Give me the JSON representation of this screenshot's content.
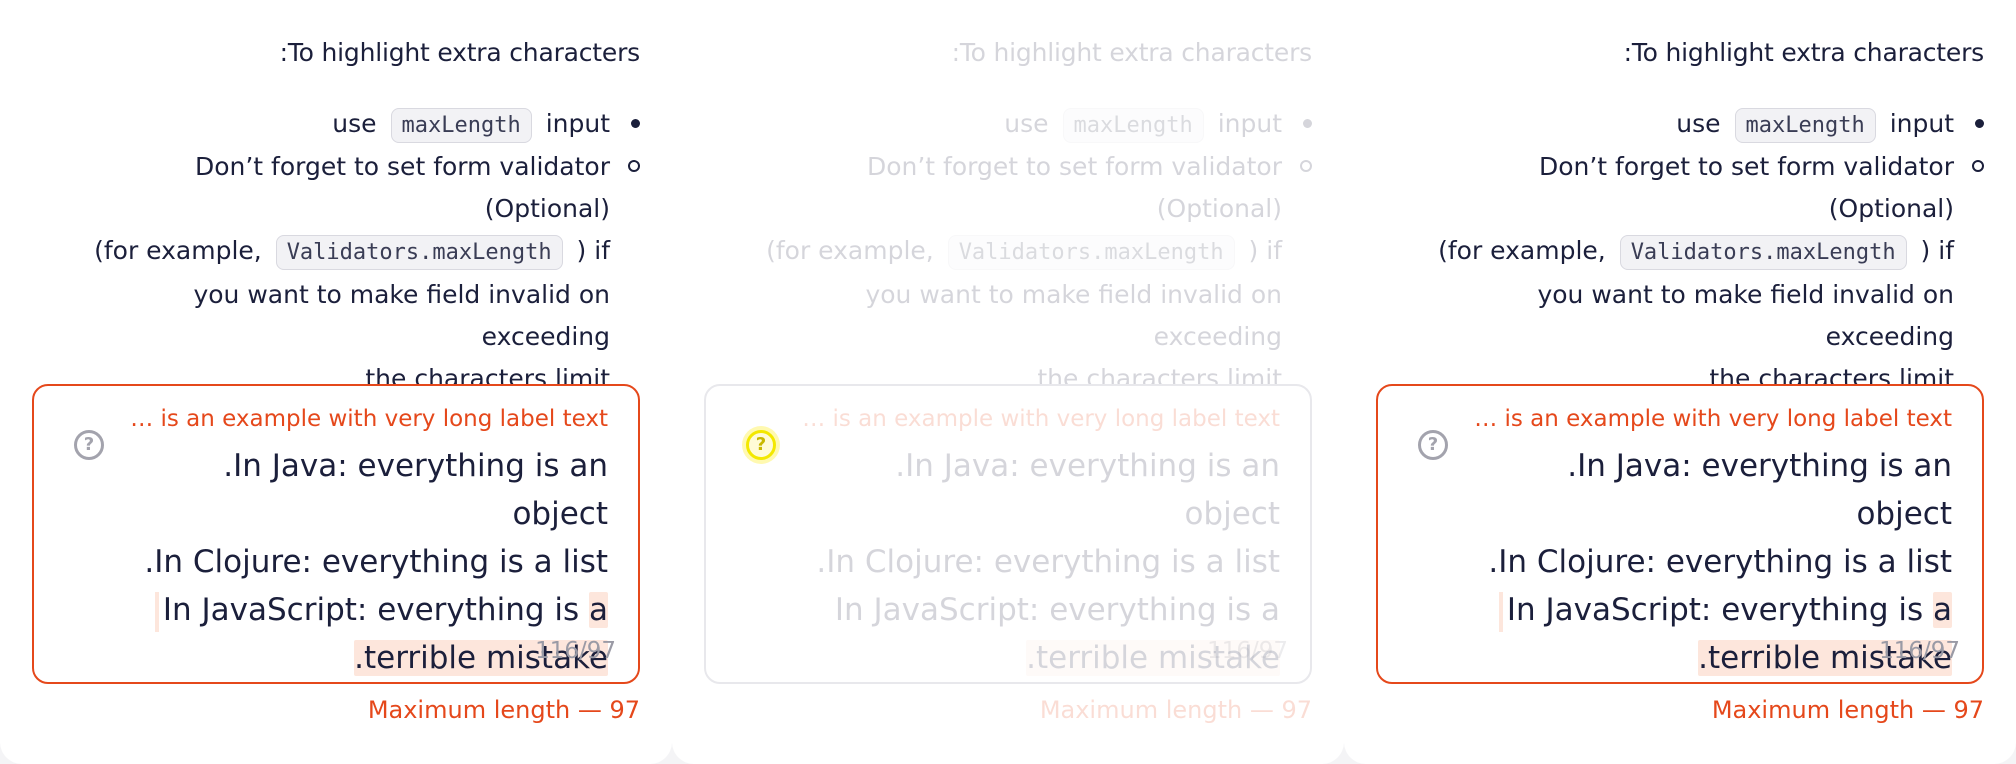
{
  "panels": [
    {
      "heading": ":To highlight extra characters",
      "bullet1": {
        "pre": "use",
        "code": "maxLength",
        "post": "input"
      },
      "bullet2": {
        "line1": "Don’t forget to set form validator (Optional)",
        "pre": "(for example,",
        "code": "Validators.maxLength",
        "post": ") if",
        "line3": "you want to make field invalid on exceeding",
        "line4": "the characters limit"
      },
      "field": {
        "label": "… is an example with very long label text",
        "help_icon": "question-circle-icon",
        "line1": ".In Java: everything is an object",
        "line2": ".In Clojure: everything is a list",
        "line3_normal": "In JavaScript: everything is ",
        "line3_extra": "a",
        "line4_extra": ".terrible mistake",
        "counter": "116/97"
      },
      "hint": "Maximum length — 97"
    },
    {
      "heading": ":To highlight extra characters",
      "bullet1": {
        "pre": "use",
        "code": "maxLength",
        "post": "input"
      },
      "bullet2": {
        "line1": "Don’t forget to set form validator (Optional)",
        "pre": "(for example,",
        "code": "Validators.maxLength",
        "post": ") if",
        "line3": "you want to make field invalid on exceeding",
        "line4": "the characters limit"
      },
      "field": {
        "label": "… is an example with very long label text",
        "help_icon": "question-circle-icon",
        "line1": ".In Java: everything is an object",
        "line2": ".In Clojure: everything is a list",
        "line3_normal": "In JavaScript: everything is a",
        "line3_extra": "",
        "line4_extra": ".terrible mistake",
        "counter": "116/97"
      },
      "hint": "Maximum length — 97"
    },
    {
      "heading": ":To highlight extra characters",
      "bullet1": {
        "pre": "use",
        "code": "maxLength",
        "post": "input"
      },
      "bullet2": {
        "line1": "Don’t forget to set form validator (Optional)",
        "pre": "(for example,",
        "code": "Validators.maxLength",
        "post": ") if",
        "line3": "you want to make field invalid on exceeding",
        "line4": "the characters limit"
      },
      "field": {
        "label": "… is an example with very long label text",
        "help_icon": "question-circle-icon",
        "line1": ".In Java: everything is an object",
        "line2": ".In Clojure: everything is a list",
        "line3_normal": "In JavaScript: everything is ",
        "line3_extra": "a",
        "line4_extra": ".terrible mistake",
        "counter": "116/97"
      },
      "hint": "Maximum length — 97"
    }
  ],
  "colors": {
    "error": "#e5481b",
    "text": "#1b1f3b",
    "muted": "#9a9aa5",
    "extra_highlight": "#fde6dc",
    "focus_highlight": "#f3e800"
  }
}
